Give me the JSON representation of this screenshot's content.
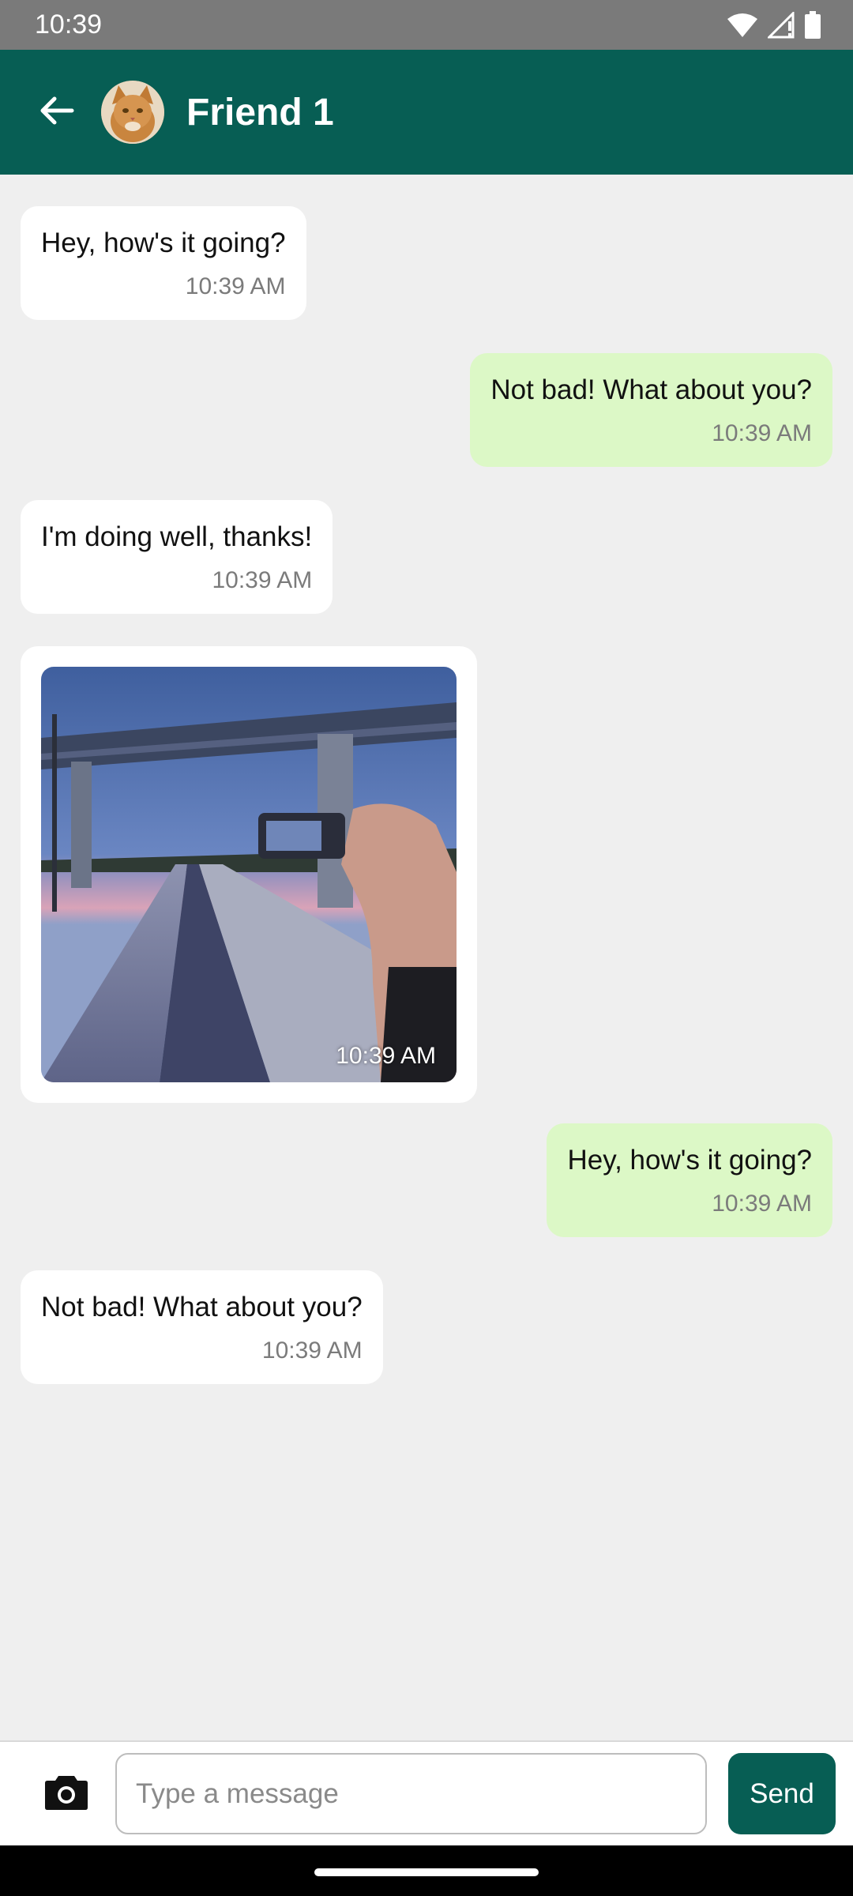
{
  "status_bar": {
    "time": "10:39",
    "icons": [
      "wifi-icon",
      "cell-signal-icon",
      "battery-icon"
    ]
  },
  "header": {
    "contact_name": "Friend 1",
    "back_icon": "arrow-left-icon",
    "avatar": "cat-avatar"
  },
  "messages": [
    {
      "direction": "incoming",
      "type": "text",
      "text": "Hey, how's it going?",
      "time": "10:39 AM"
    },
    {
      "direction": "outgoing",
      "type": "text",
      "text": "Not bad! What about you?",
      "time": "10:39 AM"
    },
    {
      "direction": "incoming",
      "type": "text",
      "text": "I'm doing well, thanks!",
      "time": "10:39 AM"
    },
    {
      "direction": "incoming",
      "type": "image",
      "time": "10:39 AM"
    },
    {
      "direction": "outgoing",
      "type": "text",
      "text": "Hey, how's it going?",
      "time": "10:39 AM"
    },
    {
      "direction": "incoming",
      "type": "text",
      "text": "Not bad! What about you?",
      "time": "10:39 AM"
    }
  ],
  "composer": {
    "placeholder": "Type a message",
    "value": "",
    "send_label": "Send",
    "camera_icon": "camera-icon"
  },
  "colors": {
    "primary": "#075e54",
    "outgoing_bubble": "#dcf8c6",
    "incoming_bubble": "#ffffff",
    "chat_background": "#efefef"
  }
}
